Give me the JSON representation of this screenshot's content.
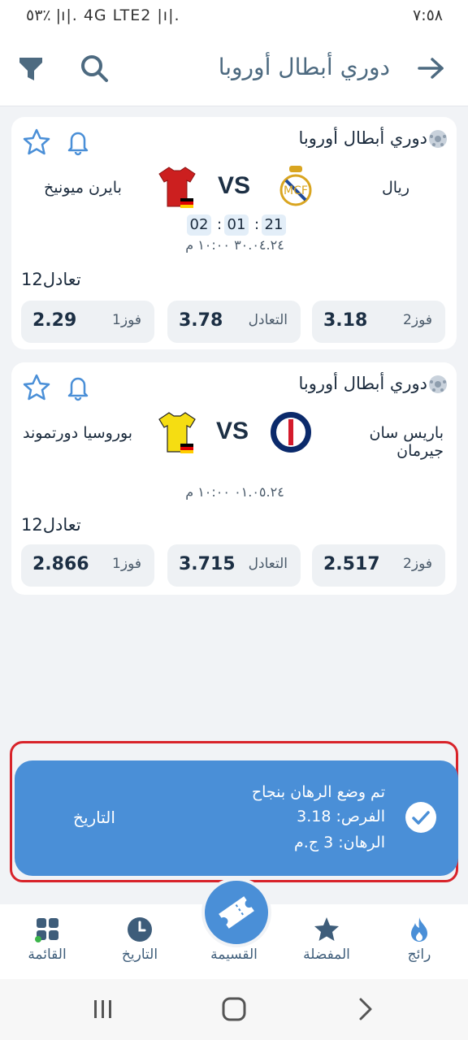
{
  "status_bar": {
    "time": "٧:٥٨",
    "icons_text": "٥٣٪ |ı|. 4G LTE2 |ı|."
  },
  "app_bar": {
    "title": "دوري أبطال أوروبا"
  },
  "matches": [
    {
      "league": "دوري أبطال أوروبا",
      "home": "ريال",
      "away": "بايرن ميونيخ",
      "vs": "VS",
      "timer": [
        "21",
        "01",
        "02"
      ],
      "date": "٣٠.٠٤.٢٤ ١٠:٠٠ م",
      "market": "1تعادل2",
      "odds": [
        {
          "label": "فوز2",
          "value": "3.18"
        },
        {
          "label": "التعادل",
          "value": "3.78"
        },
        {
          "label": "فوز1",
          "value": "2.29"
        }
      ]
    },
    {
      "league": "دوري أبطال أوروبا",
      "home": "باريس سان جيرمان",
      "away": "بوروسيا دورتموند",
      "vs": "VS",
      "date": "٠١.٠٥.٢٤ ١٠:٠٠ م",
      "market": "1تعادل2",
      "odds": [
        {
          "label": "فوز2",
          "value": "2.517"
        },
        {
          "label": "التعادل",
          "value": "3.715"
        },
        {
          "label": "فوز1",
          "value": "2.866"
        }
      ]
    }
  ],
  "toast": {
    "title": "تم وضع الرهان بنجاح",
    "odds_line": "الفرص: 3.18",
    "stake_line": "الرهان: 3 ج.م",
    "action": "التاريخ"
  },
  "bottom_nav": {
    "trending": "رائج",
    "favorites": "المفضلة",
    "coupon": "القسيمة",
    "history": "التاريخ",
    "menu": "القائمة"
  },
  "colors": {
    "accent": "#4a8fd7",
    "toast_border": "#d8232a"
  }
}
